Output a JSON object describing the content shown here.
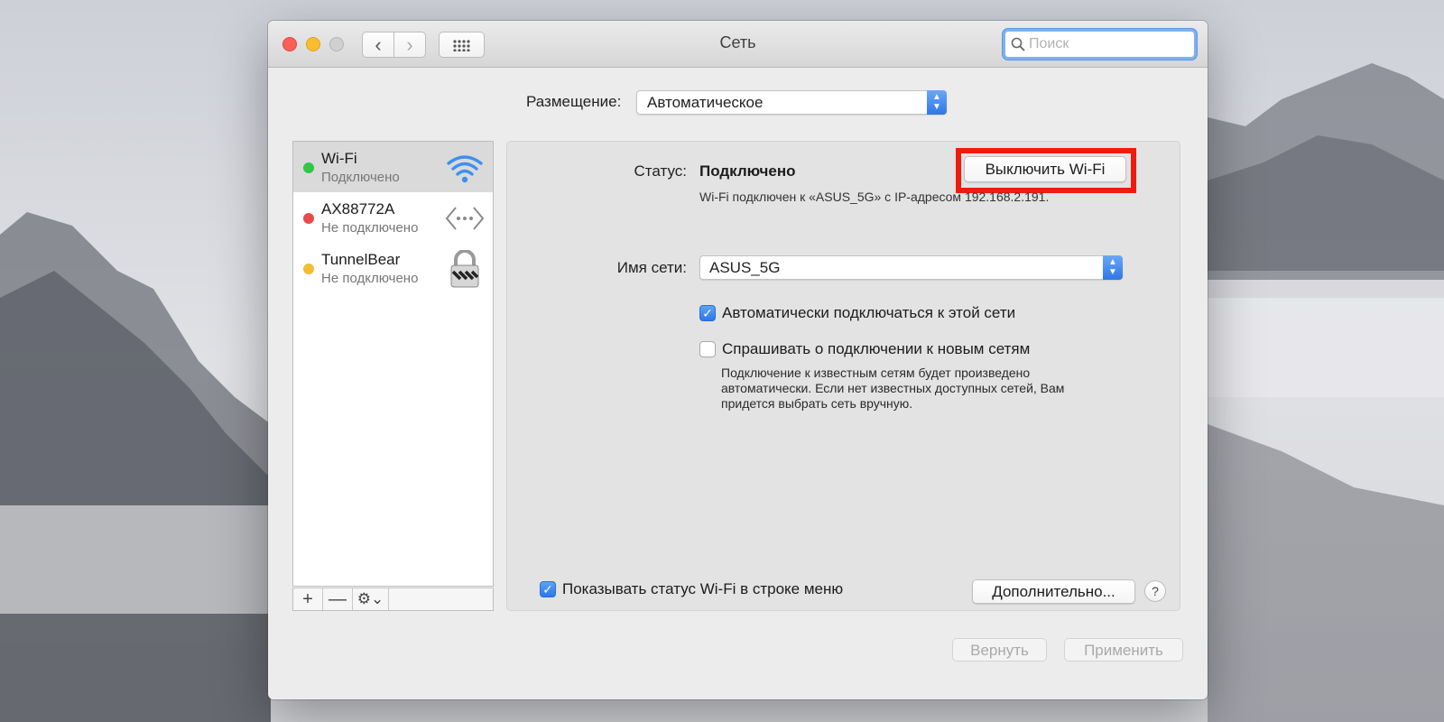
{
  "window": {
    "title": "Сеть",
    "search_placeholder": "Поиск"
  },
  "location": {
    "label": "Размещение:",
    "value": "Автоматическое"
  },
  "services": [
    {
      "name": "Wi-Fi",
      "status": "Подключено",
      "dot_color": "#2fc845",
      "icon": "wifi-icon",
      "selected": true
    },
    {
      "name": "AX88772A",
      "status": "Не подключено",
      "dot_color": "#e84b4b",
      "icon": "ethernet-icon",
      "selected": false
    },
    {
      "name": "TunnelBear",
      "status": "Не подключено",
      "dot_color": "#f3bd33",
      "icon": "vpn-lock-icon",
      "selected": false
    }
  ],
  "sidebar_toolbar": {
    "add": "+",
    "remove": "—",
    "gear": "⚙⌄"
  },
  "detail": {
    "status_label": "Статус:",
    "status_value": "Подключено",
    "wifi_off_button": "Выключить Wi-Fi",
    "status_description": "Wi-Fi подключен к «ASUS_5G» с IP-адресом 192.168.2.191.",
    "network_name_label": "Имя сети:",
    "network_name_value": "ASUS_5G",
    "auto_join_label": "Автоматически подключаться к этой сети",
    "auto_join_checked": true,
    "ask_join_label": "Спрашивать о подключении к новым сетям",
    "ask_join_checked": false,
    "ask_join_description": "Подключение к известным сетям будет произведено автоматически. Если нет известных доступных сетей, Вам придется выбрать сеть вручную.",
    "show_status_label": "Показывать статус Wi-Fi в строке меню",
    "show_status_checked": true,
    "advanced_button": "Дополнительно...",
    "help_button": "?"
  },
  "footer": {
    "revert_button": "Вернуть",
    "apply_button": "Применить"
  },
  "colors": {
    "highlight_box": "#ee1c0f",
    "accent_blue": "#2d77e9"
  }
}
